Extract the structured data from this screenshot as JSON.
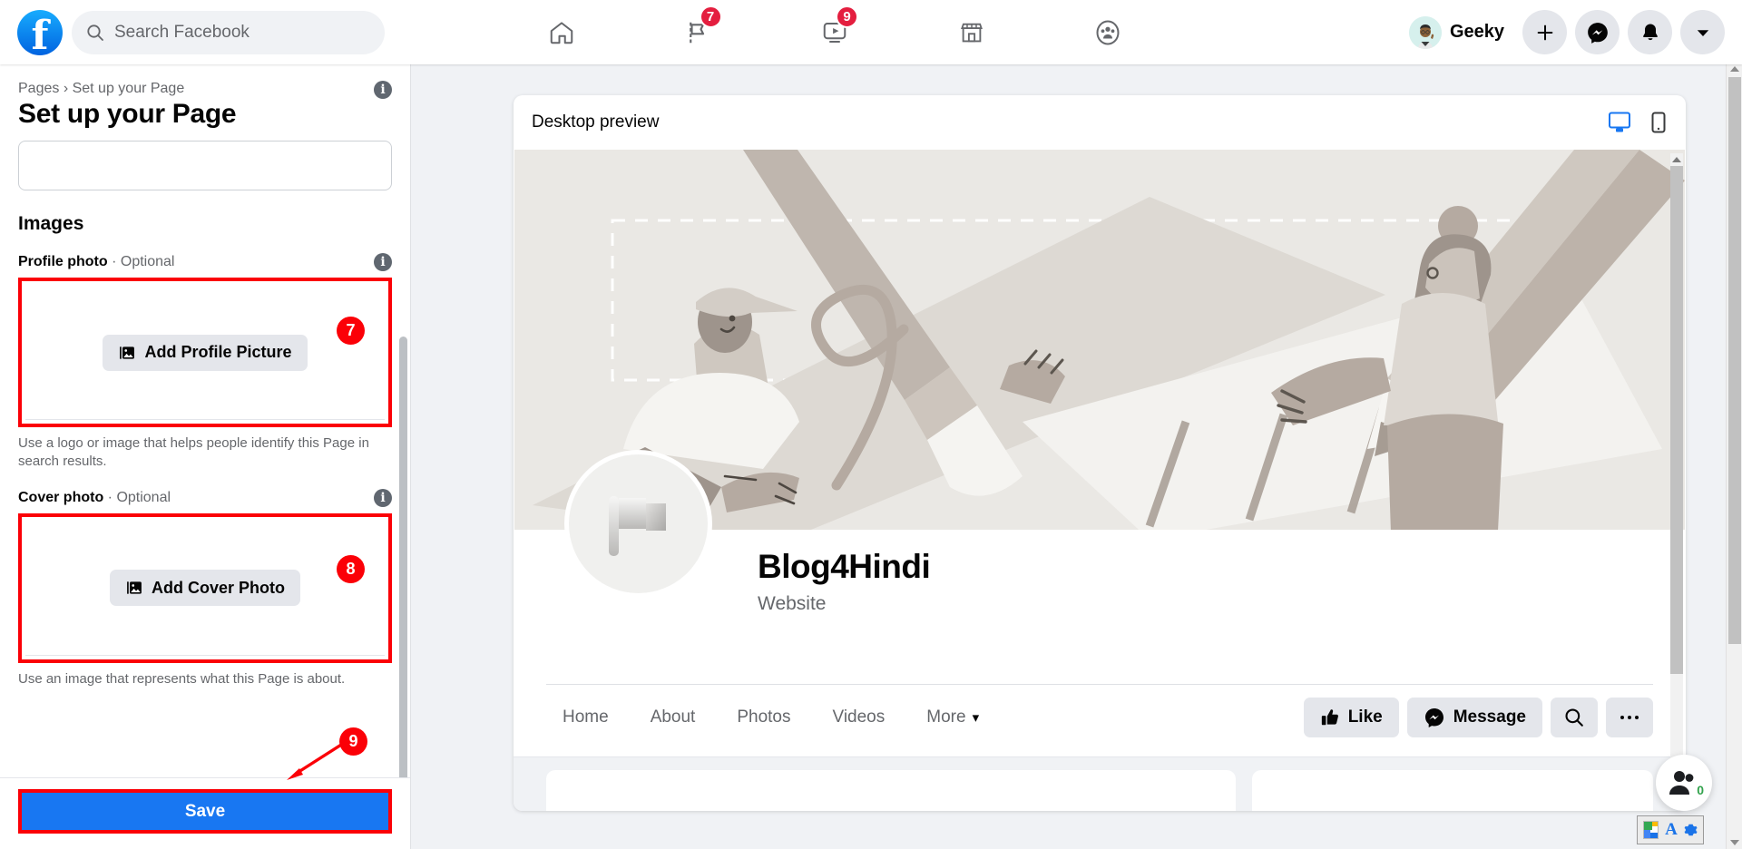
{
  "topbar": {
    "logo": "facebook-logo",
    "search_placeholder": "Search Facebook",
    "nav_items": [
      {
        "name": "home",
        "icon": "home-icon",
        "badge": ""
      },
      {
        "name": "pages",
        "icon": "flag-icon",
        "badge": "7"
      },
      {
        "name": "watch",
        "icon": "video-icon",
        "badge": "9"
      },
      {
        "name": "marketplace",
        "icon": "shop-icon",
        "badge": ""
      },
      {
        "name": "groups",
        "icon": "groups-icon",
        "badge": ""
      }
    ],
    "account_name": "Geeky",
    "actions": [
      {
        "name": "create",
        "icon": "plus-icon"
      },
      {
        "name": "messenger",
        "icon": "messenger-icon"
      },
      {
        "name": "notifications",
        "icon": "bell-icon"
      },
      {
        "name": "account-menu",
        "icon": "chevron-down-icon"
      }
    ]
  },
  "sidebar": {
    "breadcrumb": "Pages › Set up your Page",
    "title": "Set up your Page",
    "name_input_value": "",
    "images_heading": "Images",
    "profile_photo": {
      "label_bold": "Profile photo",
      "label_rest": " · Optional",
      "button_label": "Add Profile Picture",
      "step": "7",
      "helper": "Use a logo or image that helps people identify this Page in search results."
    },
    "cover_photo": {
      "label_bold": "Cover photo",
      "label_rest": " · Optional",
      "button_label": "Add Cover Photo",
      "step": "8",
      "helper": "Use an image that represents what this Page is about."
    },
    "save": {
      "label": "Save",
      "step": "9"
    },
    "accent_highlight": "#fb0007",
    "accent_primary": "#1877f2"
  },
  "preview": {
    "title": "Desktop preview",
    "view_modes": [
      {
        "name": "desktop",
        "icon": "monitor-icon",
        "active": true
      },
      {
        "name": "mobile",
        "icon": "phone-icon",
        "active": false
      }
    ],
    "page": {
      "name": "Blog4Hindi",
      "category": "Website",
      "profile_placeholder_icon": "flag-placeholder-icon"
    },
    "tabs": [
      {
        "label": "Home"
      },
      {
        "label": "About"
      },
      {
        "label": "Photos"
      },
      {
        "label": "Videos"
      },
      {
        "label": "More",
        "caret": "▾"
      }
    ],
    "actions": [
      {
        "name": "like",
        "label": "Like",
        "icon": "thumbs-up-icon"
      },
      {
        "name": "message",
        "label": "Message",
        "icon": "messenger-icon"
      },
      {
        "name": "search",
        "label": "",
        "icon": "search-icon"
      },
      {
        "name": "more",
        "label": "",
        "icon": "ellipsis-icon"
      }
    ]
  },
  "widgets": {
    "chat": {
      "icon": "people-icon",
      "count": "0"
    },
    "grammarly": {
      "icon": "extension-icon",
      "letter": "A",
      "gear": "gear-icon"
    }
  }
}
